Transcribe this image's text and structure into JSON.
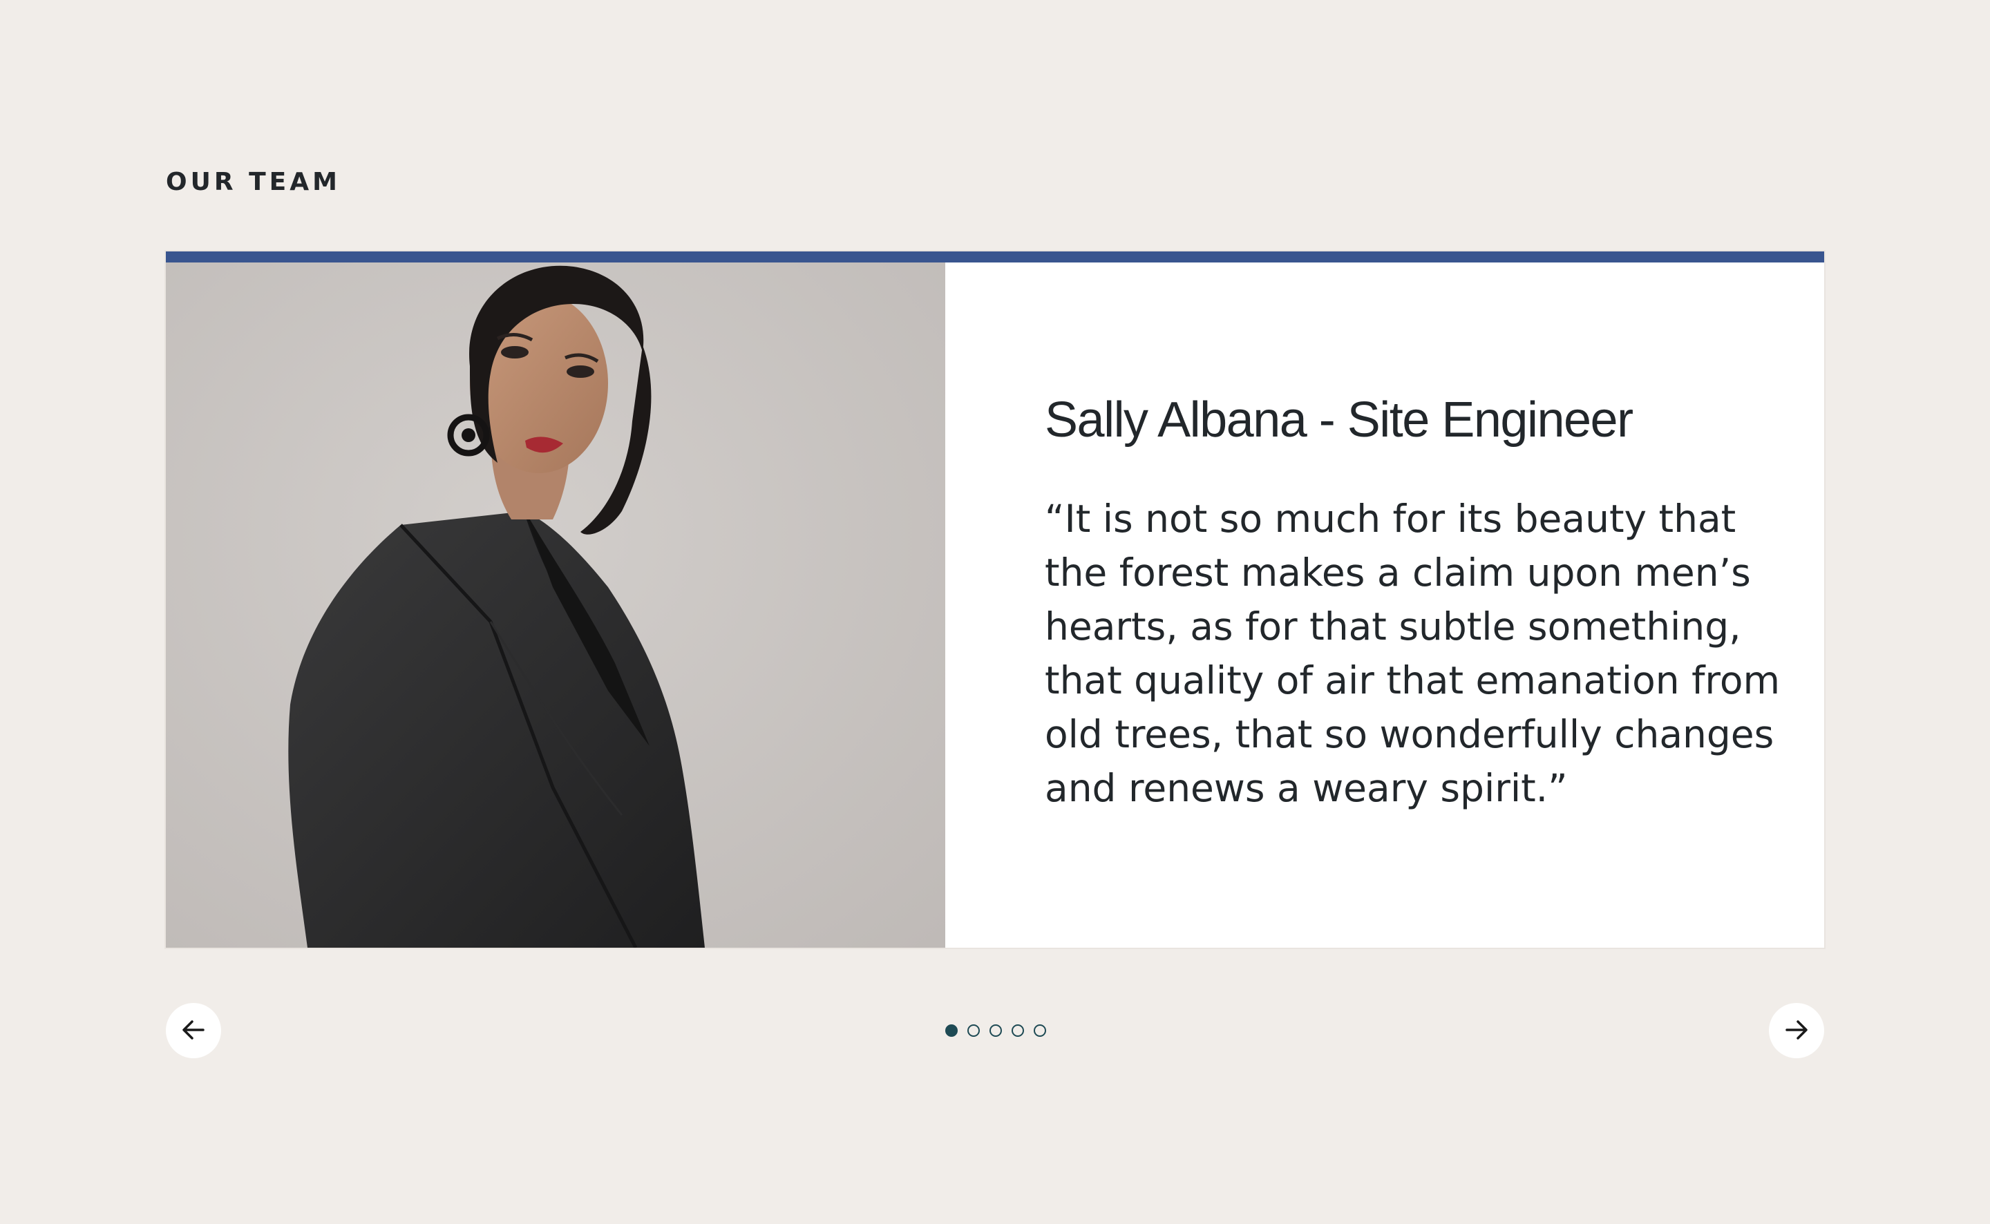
{
  "section": {
    "label": "OUR TEAM"
  },
  "slide": {
    "name": "Sally Albana - Site Engineer",
    "quote": "“It is not so much for its beauty that the forest makes a claim upon men’s hearts, as for that subtle something, that quality of air that emanation from old trees, that so wonderfully changes and renews a weary spirit.”",
    "photo_icon": "portrait-photo"
  },
  "carousel": {
    "prev_icon": "arrow-left-icon",
    "next_icon": "arrow-right-icon",
    "slide_count": 5,
    "active_index": 0
  },
  "colors": {
    "background": "#f1ede9",
    "accent_bar": "#39558f",
    "dot": "#1e4a54",
    "text": "#22272b"
  }
}
